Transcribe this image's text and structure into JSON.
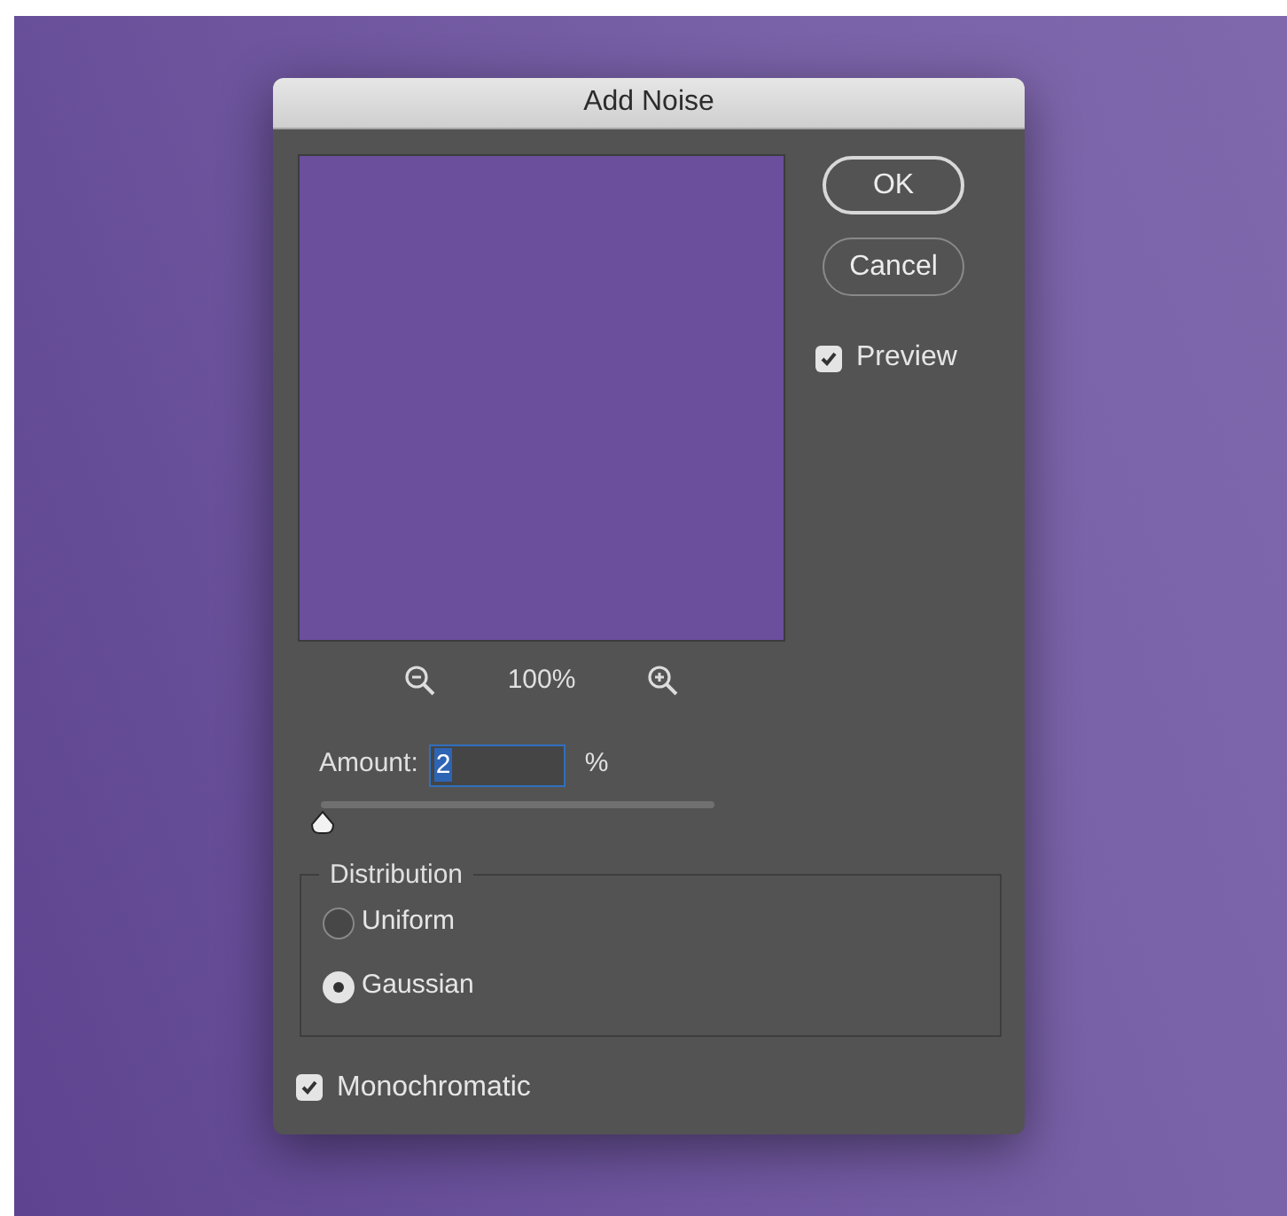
{
  "dialog": {
    "title": "Add Noise"
  },
  "buttons": [
    {
      "label": "OK",
      "kind": "default"
    },
    {
      "label": "Cancel",
      "kind": "normal"
    }
  ],
  "preview_checkbox": {
    "label": "Preview",
    "checked": true
  },
  "zoom": {
    "reading": "100%"
  },
  "amount": {
    "label": "Amount:",
    "value": "2",
    "unit": "%",
    "level": 0.005
  },
  "distribution": {
    "title": "Distribution",
    "options": [
      {
        "label": "Uniform",
        "selected": false
      },
      {
        "label": "Gaussian",
        "selected": true
      }
    ]
  },
  "monochromatic": {
    "label": "Monochromatic",
    "checked": true
  }
}
